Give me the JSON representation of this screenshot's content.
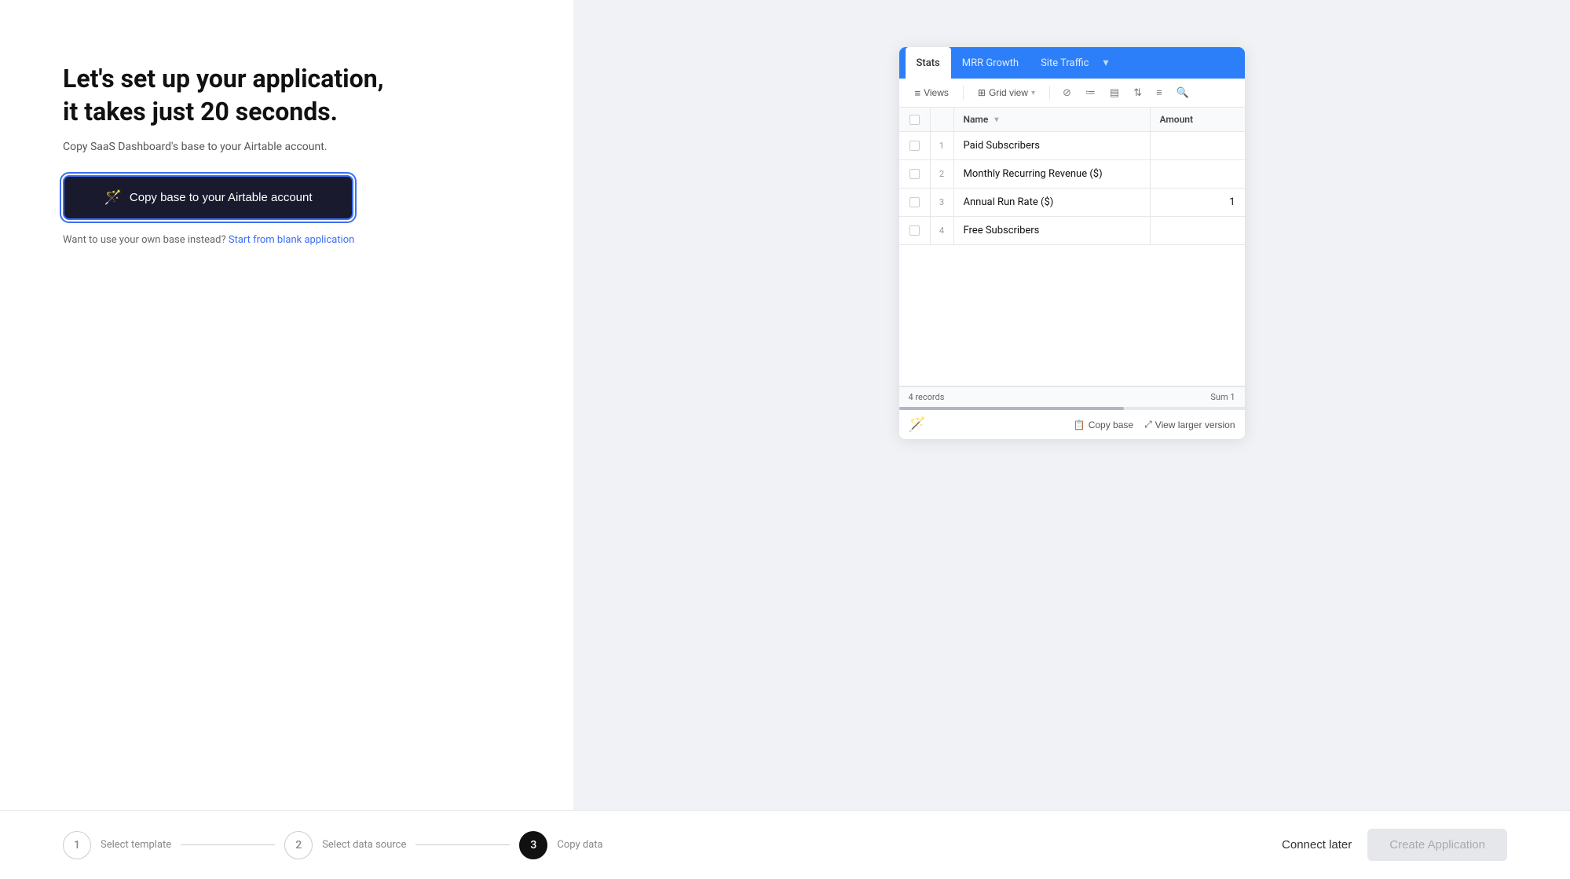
{
  "left": {
    "headline": "Let's set up your application,\nit takes just 20 seconds.",
    "subtitle": "Copy SaaS Dashboard's base to your Airtable account.",
    "cta_button": "Copy base to your Airtable account",
    "blank_prefix": "Want to use your own base instead?",
    "blank_link": "Start from blank application"
  },
  "preview": {
    "tabs": [
      {
        "label": "Stats",
        "active": true
      },
      {
        "label": "MRR Growth",
        "active": false
      },
      {
        "label": "Site Traffic",
        "active": false
      }
    ],
    "toolbar": {
      "views_label": "Views",
      "grid_view_label": "Grid view",
      "icons": [
        "hide",
        "filter",
        "group",
        "sort",
        "list",
        "search"
      ]
    },
    "table": {
      "headers": [
        "Name",
        "Amount"
      ],
      "rows": [
        {
          "num": 1,
          "name": "Paid Subscribers",
          "amount": ""
        },
        {
          "num": 2,
          "name": "Monthly Recurring Revenue ($)",
          "amount": ""
        },
        {
          "num": 3,
          "name": "Annual Run Rate ($)",
          "amount": "1"
        },
        {
          "num": 4,
          "name": "Free Subscribers",
          "amount": ""
        }
      ]
    },
    "footer": {
      "records": "4 records",
      "sum": "Sum 1"
    },
    "actions": {
      "copy_base": "Copy base",
      "view_larger": "View larger version"
    }
  },
  "bottom_bar": {
    "steps": [
      {
        "num": "1",
        "label": "Select template",
        "active": false
      },
      {
        "num": "2",
        "label": "Select data source",
        "active": false
      },
      {
        "num": "3",
        "label": "Copy data",
        "active": true
      }
    ],
    "connect_later": "Connect later",
    "create_app": "Create Application"
  }
}
